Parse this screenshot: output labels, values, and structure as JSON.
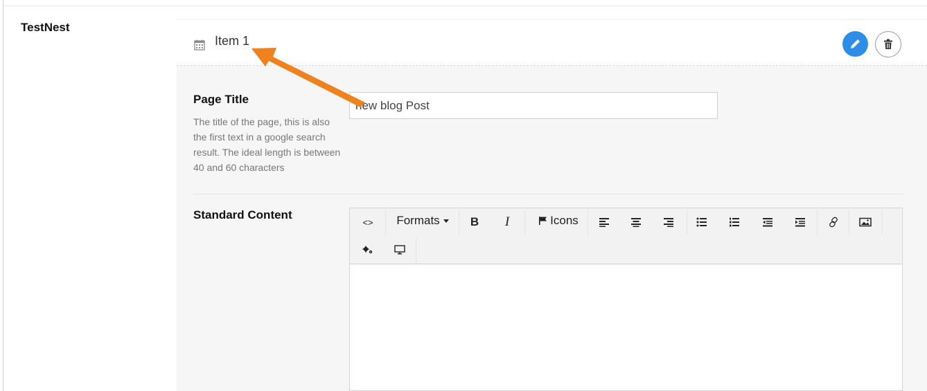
{
  "property": {
    "label": "TestNest"
  },
  "item": {
    "name": "Item 1",
    "icon": "calendar-icon"
  },
  "actions": {
    "edit": "pencil-icon",
    "delete": "trash-icon",
    "edit_color": "#2e8ee7"
  },
  "fields": {
    "page_title": {
      "label": "Page Title",
      "description": "The title of the page, this is also the first text in a google search result. The ideal length is between 40 and 60 characters",
      "value": "new blog Post"
    },
    "standard_content": {
      "label": "Standard Content"
    }
  },
  "toolbar": {
    "formats_label": "Formats",
    "icons_label": "Icons",
    "bold": "B",
    "italic": "I",
    "source_code": "<>"
  },
  "annotation": {
    "arrow_color": "#f0821e"
  }
}
